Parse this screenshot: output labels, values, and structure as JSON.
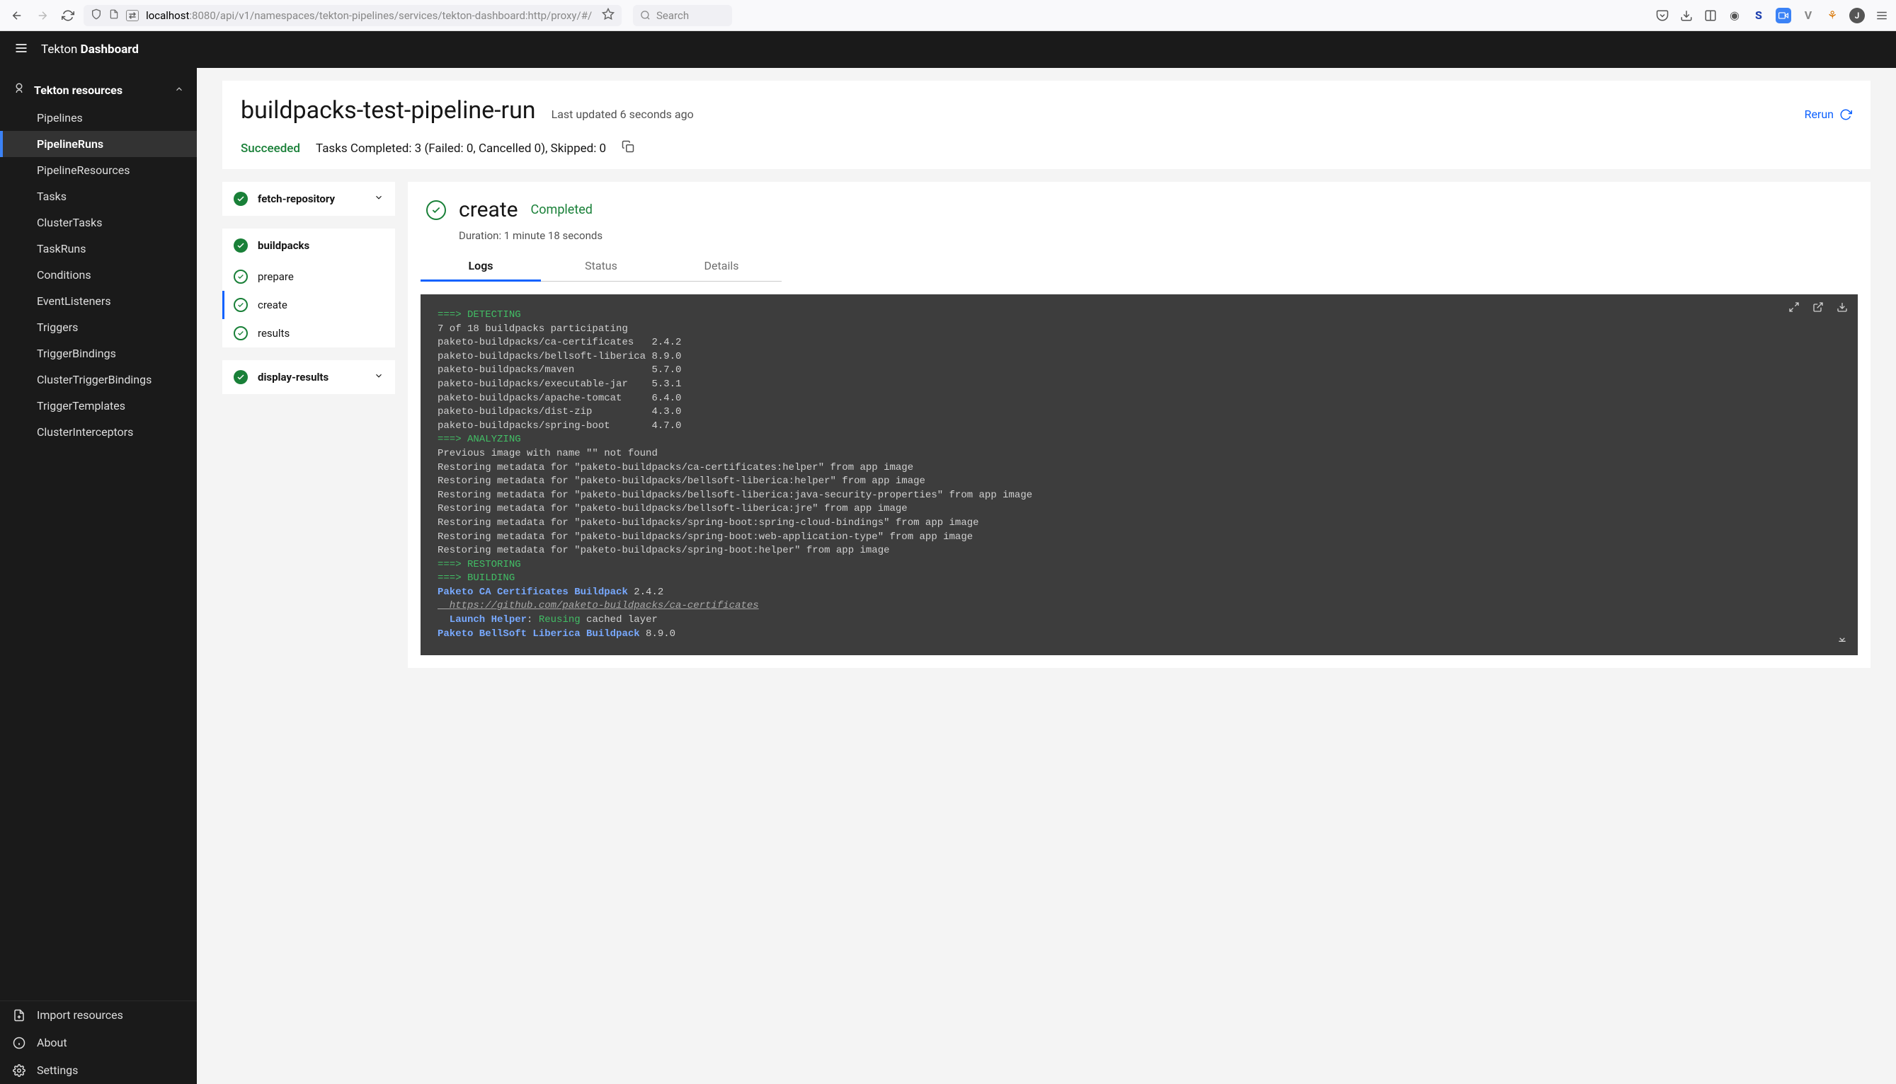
{
  "browser": {
    "url_dim_prefix": "localhost",
    "url_rest": ":8080/api/v1/namespaces/tekton-pipelines/services/tekton-dashboard:http/proxy/#/",
    "search_placeholder": "Search"
  },
  "app": {
    "brand_light": "Tekton ",
    "brand_bold": "Dashboard"
  },
  "sidebar": {
    "section_label": "Tekton resources",
    "items": [
      "Pipelines",
      "PipelineRuns",
      "PipelineResources",
      "Tasks",
      "ClusterTasks",
      "TaskRuns",
      "Conditions",
      "EventListeners",
      "Triggers",
      "TriggerBindings",
      "ClusterTriggerBindings",
      "TriggerTemplates",
      "ClusterInterceptors"
    ],
    "active_index": 1,
    "bottom": [
      "Import resources",
      "About",
      "Settings"
    ]
  },
  "run": {
    "title": "buildpacks-test-pipeline-run",
    "updated": "Last updated 6 seconds ago",
    "rerun_label": "Rerun",
    "status": "Succeeded",
    "summary": "Tasks Completed: 3 (Failed: 0, Cancelled 0), Skipped: 0"
  },
  "tasks": [
    {
      "name": "fetch-repository",
      "expanded": false,
      "steps": []
    },
    {
      "name": "buildpacks",
      "expanded": true,
      "steps": [
        "prepare",
        "create",
        "results"
      ],
      "active_step_index": 1
    },
    {
      "name": "display-results",
      "expanded": false,
      "steps": []
    }
  ],
  "detail": {
    "title": "create",
    "status": "Completed",
    "duration": "Duration: 1 minute 18 seconds",
    "tabs": [
      "Logs",
      "Status",
      "Details"
    ],
    "active_tab_index": 0
  },
  "log": {
    "lines": [
      {
        "cls": "green",
        "text": "===> DETECTING"
      },
      {
        "cls": "",
        "text": "7 of 18 buildpacks participating"
      },
      {
        "cls": "",
        "text": "paketo-buildpacks/ca-certificates   2.4.2"
      },
      {
        "cls": "",
        "text": "paketo-buildpacks/bellsoft-liberica 8.9.0"
      },
      {
        "cls": "",
        "text": "paketo-buildpacks/maven             5.7.0"
      },
      {
        "cls": "",
        "text": "paketo-buildpacks/executable-jar    5.3.1"
      },
      {
        "cls": "",
        "text": "paketo-buildpacks/apache-tomcat     6.4.0"
      },
      {
        "cls": "",
        "text": "paketo-buildpacks/dist-zip          4.3.0"
      },
      {
        "cls": "",
        "text": "paketo-buildpacks/spring-boot       4.7.0"
      },
      {
        "cls": "green",
        "text": "===> ANALYZING"
      },
      {
        "cls": "",
        "text": "Previous image with name \"\" not found"
      },
      {
        "cls": "",
        "text": "Restoring metadata for \"paketo-buildpacks/ca-certificates:helper\" from app image"
      },
      {
        "cls": "",
        "text": "Restoring metadata for \"paketo-buildpacks/bellsoft-liberica:helper\" from app image"
      },
      {
        "cls": "",
        "text": "Restoring metadata for \"paketo-buildpacks/bellsoft-liberica:java-security-properties\" from app image"
      },
      {
        "cls": "",
        "text": "Restoring metadata for \"paketo-buildpacks/bellsoft-liberica:jre\" from app image"
      },
      {
        "cls": "",
        "text": "Restoring metadata for \"paketo-buildpacks/spring-boot:spring-cloud-bindings\" from app image"
      },
      {
        "cls": "",
        "text": "Restoring metadata for \"paketo-buildpacks/spring-boot:web-application-type\" from app image"
      },
      {
        "cls": "",
        "text": "Restoring metadata for \"paketo-buildpacks/spring-boot:helper\" from app image"
      },
      {
        "cls": "green",
        "text": "===> RESTORING"
      },
      {
        "cls": "green",
        "text": "===> BUILDING"
      },
      {
        "cls": "mix",
        "segments": [
          {
            "cls": "blue",
            "text": "Paketo CA Certificates Buildpack"
          },
          {
            "cls": "",
            "text": " 2.4.2"
          }
        ]
      },
      {
        "cls": "grey",
        "text": "  https://github.com/paketo-buildpacks/ca-certificates"
      },
      {
        "cls": "mix",
        "segments": [
          {
            "cls": "blue",
            "text": "  Launch Helper"
          },
          {
            "cls": "",
            "text": ": "
          },
          {
            "cls": "green",
            "text": "Reusing"
          },
          {
            "cls": "",
            "text": " cached layer"
          }
        ]
      },
      {
        "cls": "mix",
        "segments": [
          {
            "cls": "blue",
            "text": "Paketo BellSoft Liberica Buildpack"
          },
          {
            "cls": "",
            "text": " 8.9.0"
          }
        ]
      }
    ]
  }
}
